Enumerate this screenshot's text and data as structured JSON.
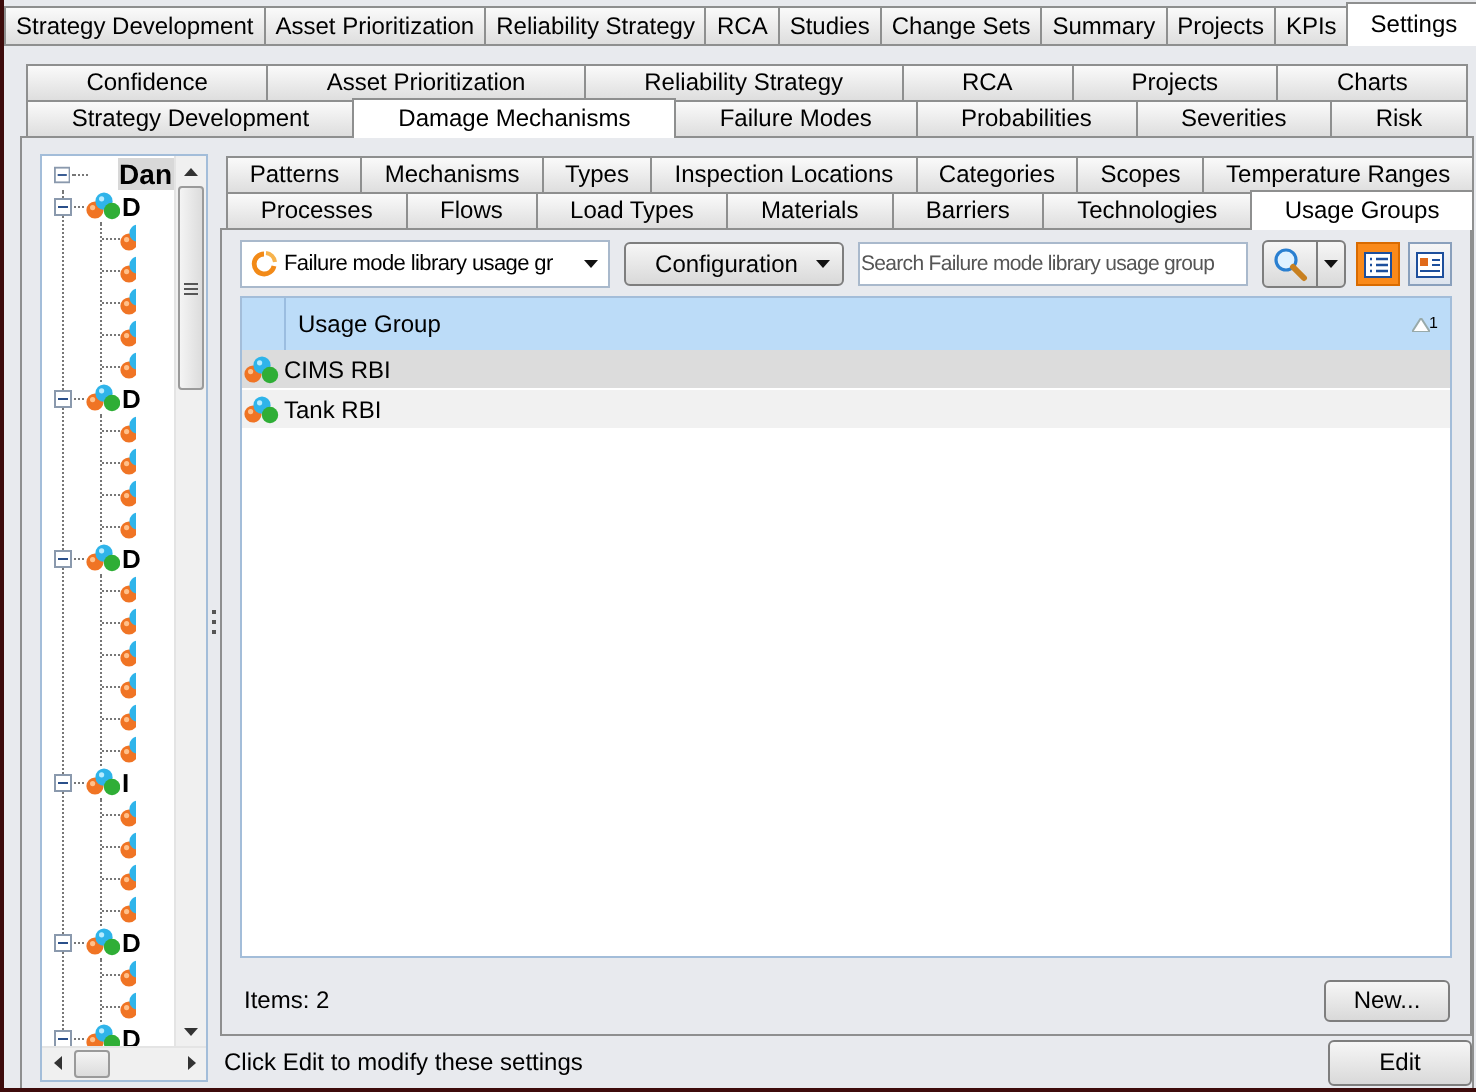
{
  "main_tabs": [
    {
      "label": "Strategy Development",
      "selected": false
    },
    {
      "label": "Asset Prioritization",
      "selected": false
    },
    {
      "label": "Reliability Strategy",
      "selected": false
    },
    {
      "label": "RCA",
      "selected": false
    },
    {
      "label": "Studies",
      "selected": false
    },
    {
      "label": "Change Sets",
      "selected": false
    },
    {
      "label": "Summary",
      "selected": false
    },
    {
      "label": "Projects",
      "selected": false
    },
    {
      "label": "KPIs",
      "selected": false
    },
    {
      "label": "Settings",
      "selected": true
    }
  ],
  "settings_tab_rows": [
    {
      "tabs": [
        {
          "label": "Confidence",
          "selected": false
        },
        {
          "label": "Asset Prioritization",
          "selected": false
        },
        {
          "label": "Reliability Strategy",
          "selected": false
        },
        {
          "label": "RCA",
          "selected": false
        },
        {
          "label": "Projects",
          "selected": false
        },
        {
          "label": "Charts",
          "selected": false
        }
      ]
    },
    {
      "tabs": [
        {
          "label": "Strategy Development",
          "selected": false
        },
        {
          "label": "Damage Mechanisms",
          "selected": true
        },
        {
          "label": "Failure Modes",
          "selected": false
        },
        {
          "label": "Probabilities",
          "selected": false
        },
        {
          "label": "Severities",
          "selected": false
        },
        {
          "label": "Risk",
          "selected": false
        }
      ]
    }
  ],
  "tree": {
    "label": "Dan",
    "expanded": true,
    "children": [
      {
        "kind": "group",
        "label": "D",
        "expanded": true,
        "children": [
          {
            "kind": "leaf"
          },
          {
            "kind": "leaf"
          },
          {
            "kind": "leaf"
          },
          {
            "kind": "leaf"
          },
          {
            "kind": "leaf"
          }
        ]
      },
      {
        "kind": "group",
        "label": "D",
        "expanded": true,
        "children": [
          {
            "kind": "leaf"
          },
          {
            "kind": "leaf"
          },
          {
            "kind": "leaf"
          },
          {
            "kind": "leaf"
          }
        ]
      },
      {
        "kind": "group",
        "label": "D",
        "expanded": true,
        "children": [
          {
            "kind": "leaf"
          },
          {
            "kind": "leaf"
          },
          {
            "kind": "leaf"
          },
          {
            "kind": "leaf"
          },
          {
            "kind": "leaf"
          },
          {
            "kind": "leaf"
          }
        ]
      },
      {
        "kind": "group",
        "label": "I",
        "expanded": true,
        "children": [
          {
            "kind": "leaf"
          },
          {
            "kind": "leaf"
          },
          {
            "kind": "leaf"
          },
          {
            "kind": "leaf"
          }
        ]
      },
      {
        "kind": "group",
        "label": "D",
        "expanded": true,
        "children": [
          {
            "kind": "leaf"
          },
          {
            "kind": "leaf"
          }
        ]
      },
      {
        "kind": "group",
        "label": "D",
        "expanded": true
      }
    ]
  },
  "data_tab_rows": [
    {
      "tabs": [
        {
          "label": "Patterns",
          "selected": false
        },
        {
          "label": "Mechanisms",
          "selected": false
        },
        {
          "label": "Types",
          "selected": false
        },
        {
          "label": "Inspection Locations",
          "selected": false
        },
        {
          "label": "Categories",
          "selected": false
        },
        {
          "label": "Scopes",
          "selected": false
        },
        {
          "label": "Temperature Ranges",
          "selected": false
        }
      ]
    },
    {
      "tabs": [
        {
          "label": "Processes",
          "selected": false
        },
        {
          "label": "Flows",
          "selected": false
        },
        {
          "label": "Load Types",
          "selected": false
        },
        {
          "label": "Materials",
          "selected": false
        },
        {
          "label": "Barriers",
          "selected": false
        },
        {
          "label": "Technologies",
          "selected": false
        },
        {
          "label": "Usage Groups",
          "selected": true
        }
      ]
    }
  ],
  "toolbar": {
    "library_dropdown": "Failure mode library usage gr",
    "configuration_button": "Configuration",
    "search": {
      "placeholder": "Search Failure mode library usage group"
    },
    "view_buttons": [
      {
        "kind": "list",
        "selected": true
      },
      {
        "kind": "details",
        "selected": false
      }
    ]
  },
  "grid": {
    "columns": [
      {
        "label": "Usage Group",
        "sorted_ascending": true,
        "sort_index": "1"
      }
    ],
    "rows": [
      {
        "label": "CIMS RBI",
        "selected": true
      },
      {
        "label": "Tank RBI",
        "selected": false
      }
    ]
  },
  "footer": {
    "items_count": "Items: 2",
    "new_button": "New..."
  },
  "status_bar": {
    "text": "Click Edit to modify these settings",
    "edit_button": "Edit"
  }
}
